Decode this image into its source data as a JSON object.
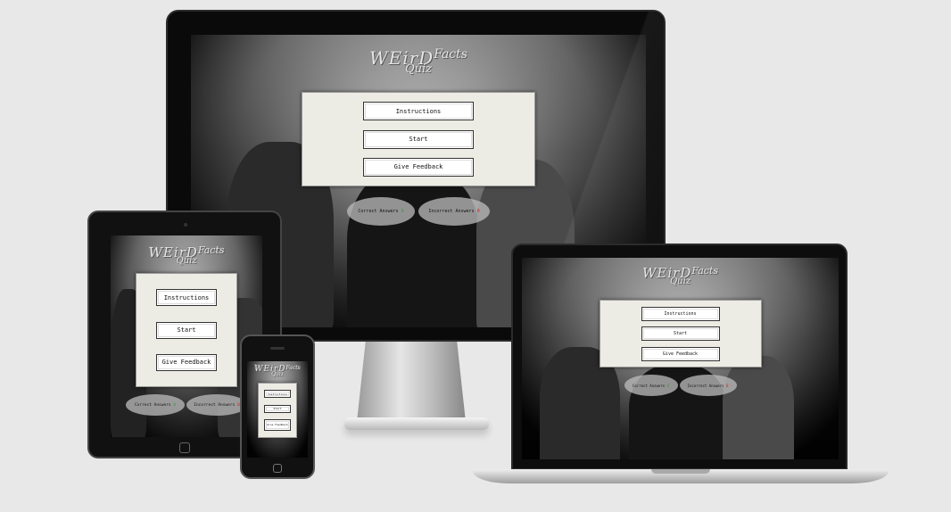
{
  "app": {
    "logo": {
      "word1": "WEirD",
      "word2": "Facts",
      "word3": "Quiz"
    },
    "buttons": {
      "instructions": "Instructions",
      "start": "Start",
      "feedback": "Give Feedback"
    },
    "scores": {
      "correct_label": "Correct Answers",
      "incorrect_label": "Incorrect Answers",
      "correct_value": "0",
      "incorrect_value": "0"
    }
  },
  "colors": {
    "page_background": "#e8e8e8",
    "panel_background": "#ecebe4",
    "correct_accent": "#3c9b3c",
    "incorrect_accent": "#dd2222"
  }
}
